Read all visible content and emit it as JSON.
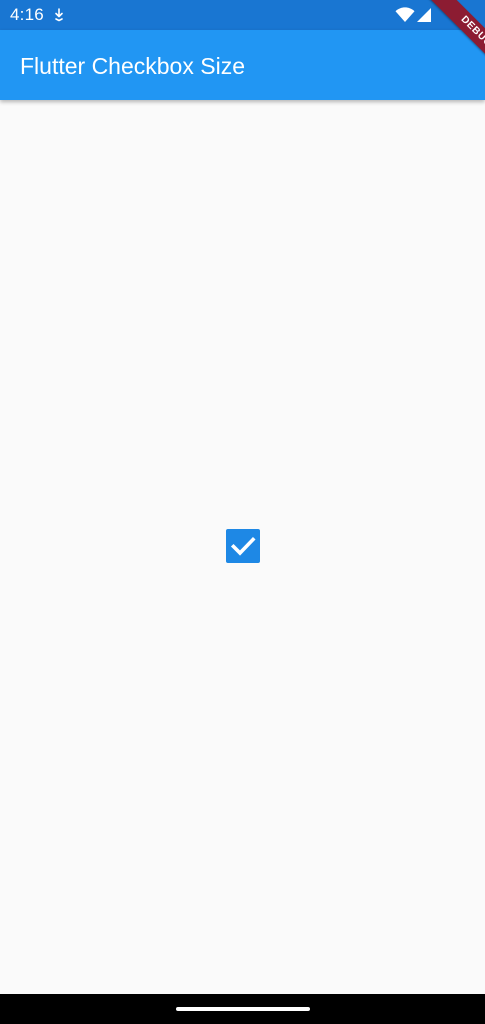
{
  "status_bar": {
    "time": "4:16",
    "background": "#1976d2",
    "icons": [
      "download-icon",
      "wifi-icon",
      "cell-signal-icon"
    ]
  },
  "app_bar": {
    "title": "Flutter Checkbox Size",
    "background": "#2196f3"
  },
  "debug_banner": {
    "label": "DEBUG",
    "color": "#8c1c32"
  },
  "content": {
    "background": "#fafafa",
    "checkbox": {
      "checked": true,
      "color": "#1e88e5",
      "icon": "check-icon"
    }
  },
  "nav_bar": {
    "background": "#000000",
    "icon": "home-indicator"
  }
}
